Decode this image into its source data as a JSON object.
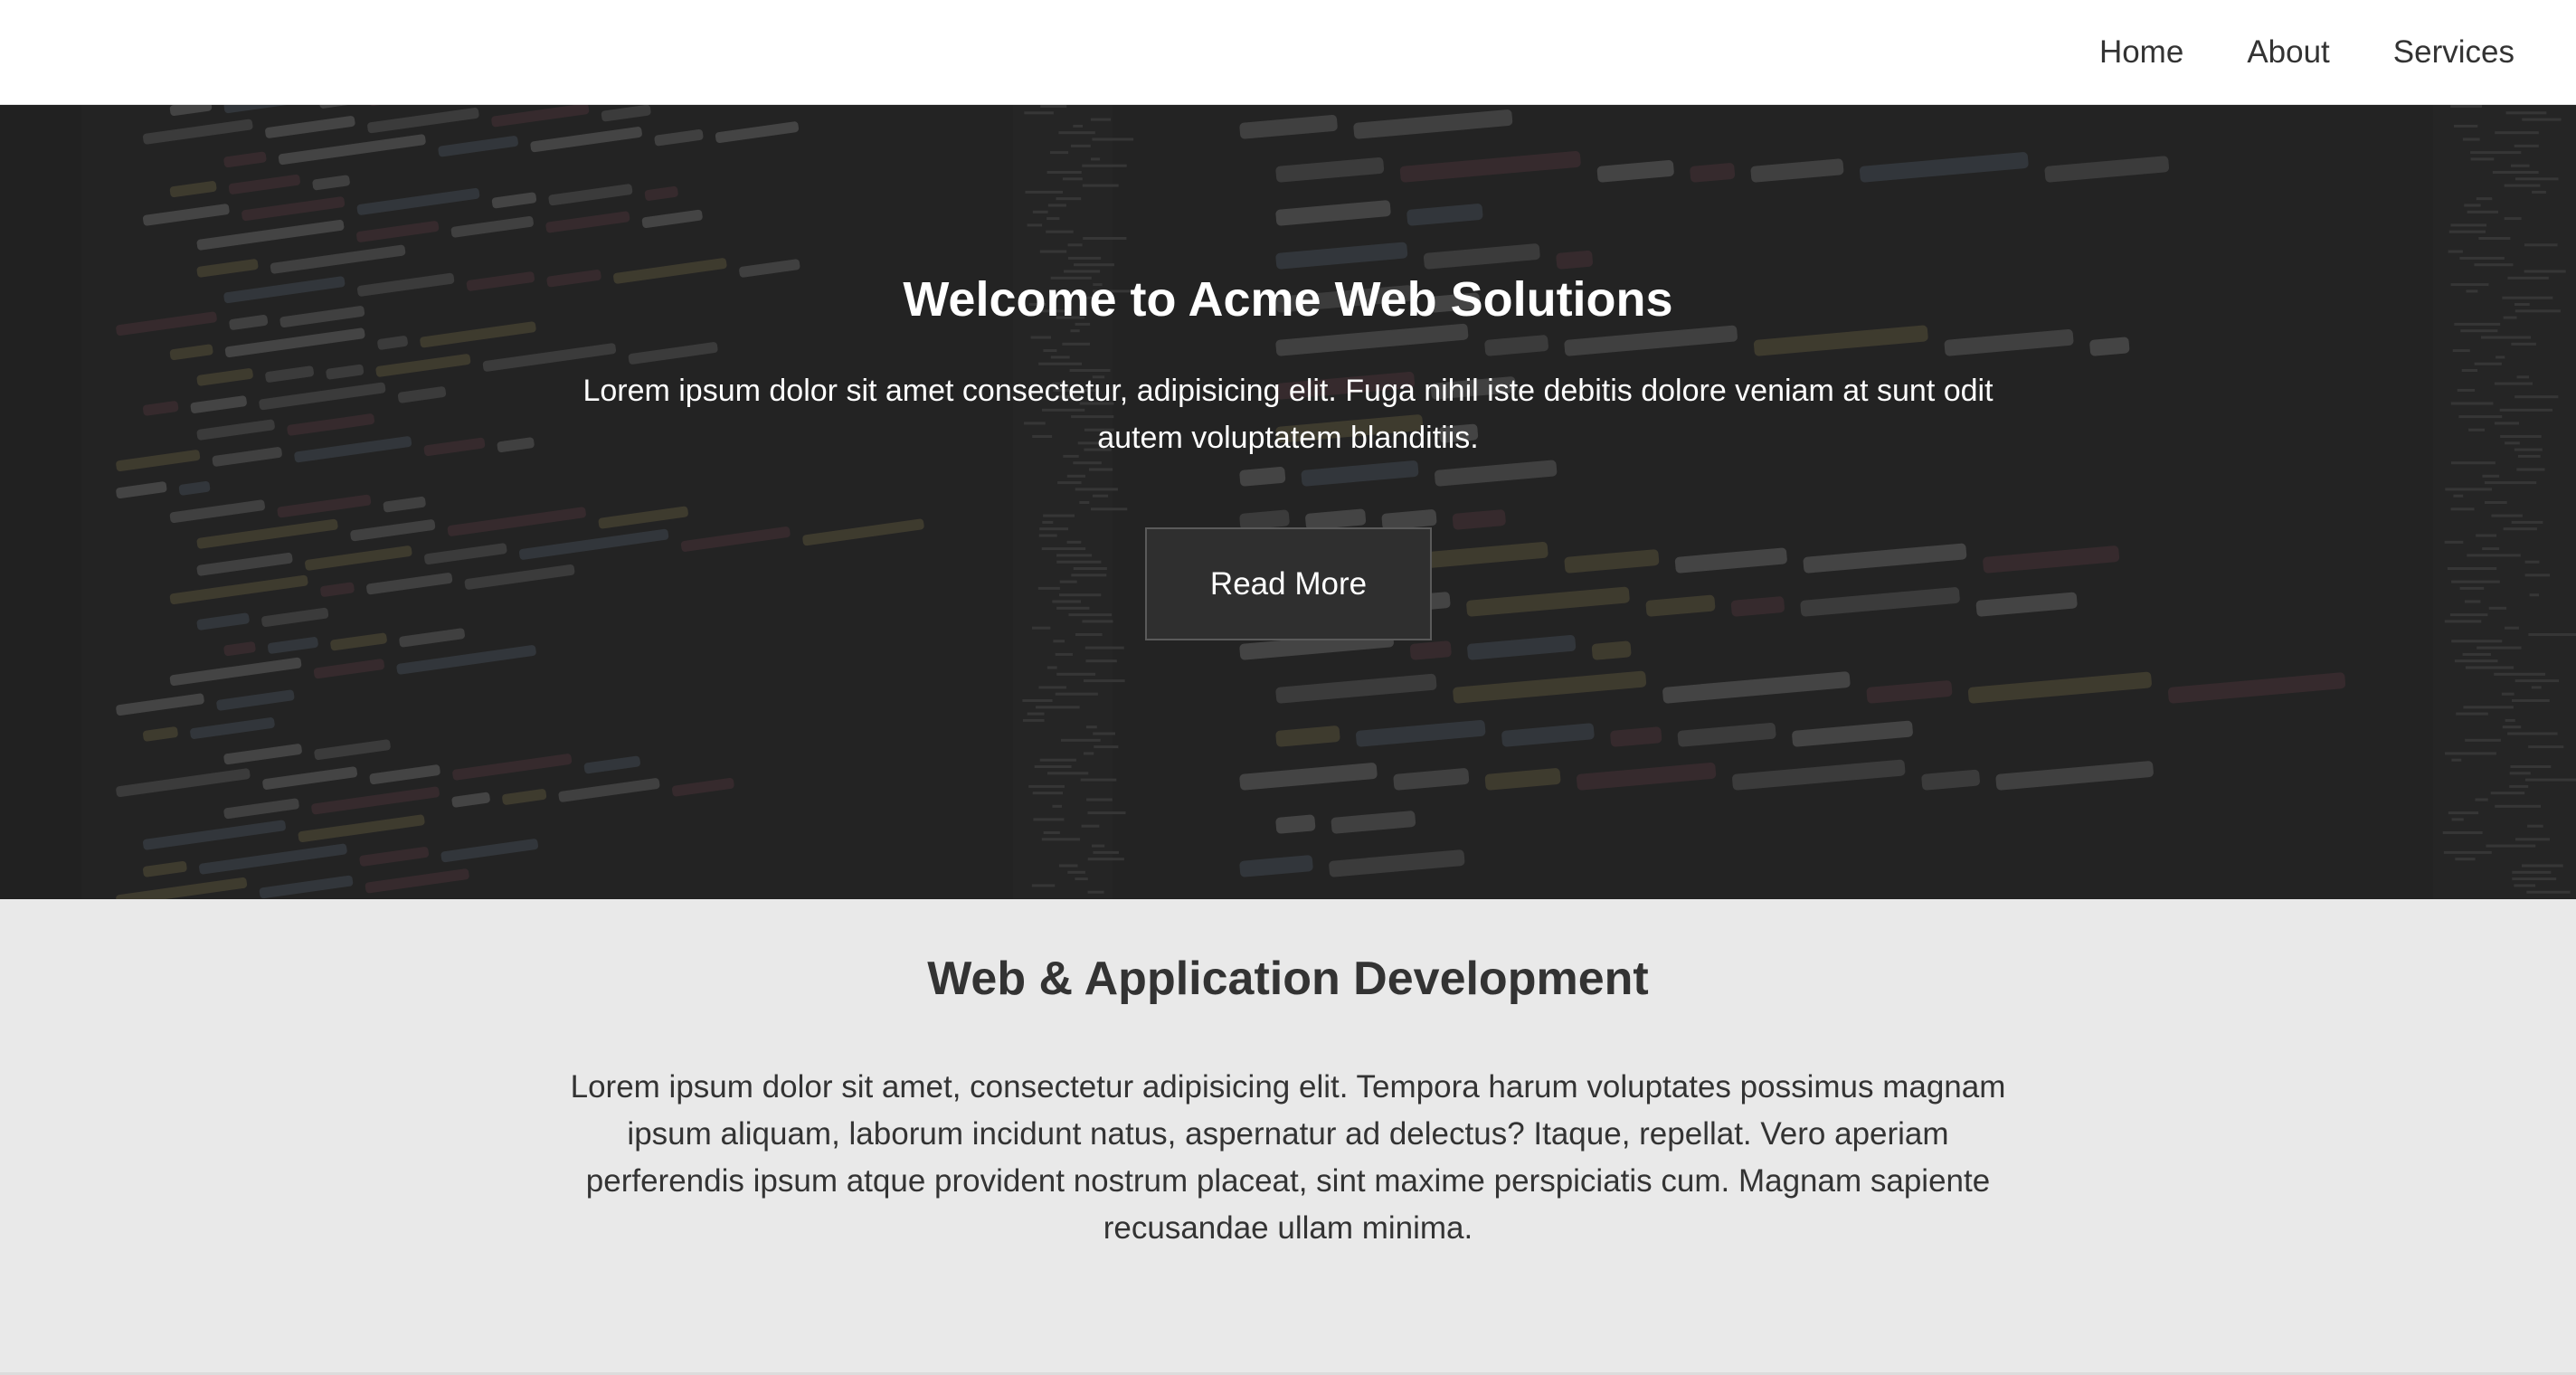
{
  "nav": {
    "items": [
      {
        "label": "Home"
      },
      {
        "label": "About"
      },
      {
        "label": "Services"
      }
    ]
  },
  "hero": {
    "title": "Welcome to Acme Web Solutions",
    "text": "Lorem ipsum dolor sit amet consectetur, adipisicing elit. Fuga nihil iste debitis dolore veniam at sunt odit autem voluptatem blanditiis.",
    "button_label": "Read More",
    "background": "code-editor-background"
  },
  "section": {
    "title": "Web & Application Development",
    "text": "Lorem ipsum dolor sit amet, consectetur adipisicing elit. Tempora harum voluptates possimus magnam ipsum aliquam, laborum incidunt natus, aspernatur ad delectus? Itaque, repellat. Vero aperiam perferendis ipsum atque provident nostrum placeat, sint maxime perspiciatis cum. Magnam sapiente recusandae ullam minima."
  },
  "colors": {
    "nav_bg": "#ffffff",
    "nav_text": "#333333",
    "hero_overlay": "#1e1e1e",
    "section_bg": "#e9e9e9",
    "text_dark": "#333333",
    "text_light": "#ffffff"
  }
}
